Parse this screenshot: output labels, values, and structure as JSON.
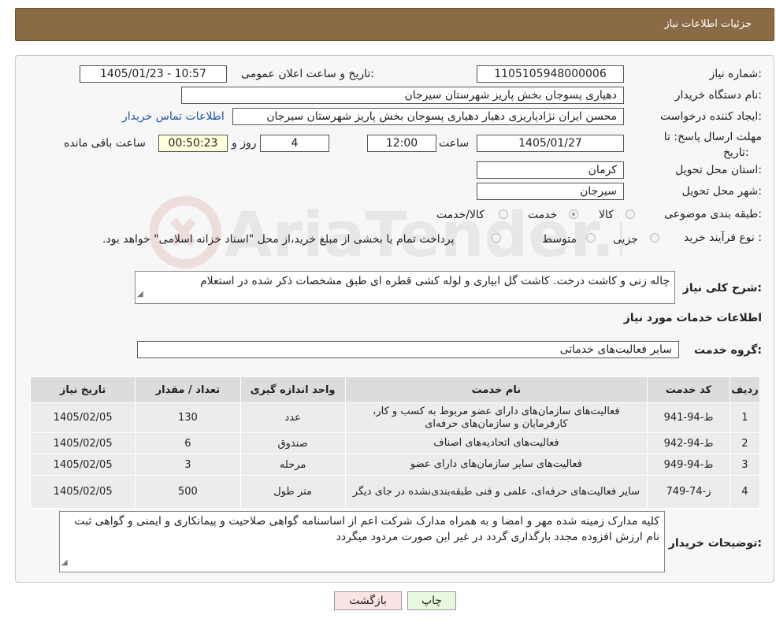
{
  "header": {
    "title": "جزئیات اطلاعات نیاز"
  },
  "form": {
    "need_number": {
      "label": "شماره نیاز:",
      "value": "1105105948000006"
    },
    "announce_datetime": {
      "label": "تاریخ و ساعت اعلان عمومی:",
      "value": "1405/01/23 - 10:57"
    },
    "buyer_org": {
      "label": "نام دستگاه خریدار:",
      "value": "دهیاری پسوجان بخش پاریز شهرستان سیرجان"
    },
    "requester": {
      "label": "ایجاد کننده درخواست:",
      "value": "محسن ایران نژادپاریزی دهیار دهیاری پسوجان بخش پاریز شهرستان سیرجان",
      "contact_link": "اطلاعات تماس خریدار"
    },
    "deadline": {
      "label": "مهلت ارسال پاسخ: تا تاریخ:",
      "date": "1405/01/27",
      "time_label": "ساعت",
      "time": "12:00",
      "days": "4",
      "days_label": "روز و",
      "remaining": "00:50:23",
      "remaining_label": "ساعت باقی مانده"
    },
    "delivery_province": {
      "label": "استان محل تحویل:",
      "value": "کرمان"
    },
    "delivery_city": {
      "label": "شهر محل تحویل:",
      "value": "سیرجان"
    },
    "category": {
      "label": "طبقه بندی موضوعی:",
      "options": [
        "کالا",
        "خدمت",
        "کالا/خدمت"
      ],
      "selected": "خدمت"
    },
    "purchase_process": {
      "label": "نوع فرآیند خرید :",
      "options": [
        "جزیی",
        "متوسط"
      ],
      "note": "پرداخت تمام یا بخشی از مبلغ خرید،از محل \"اسناد خزانه اسلامی\" خواهد بود."
    },
    "summary": {
      "label": "شرح کلی نیاز:",
      "value": "چاله زنی و کاشت درخت. کاشت گل ابیاری و لوله کشی قطره ای طبق مشخصات ذکر شده در استعلام"
    }
  },
  "services": {
    "section_title": "اطلاعات خدمات مورد نیاز",
    "group_label": "گروه خدمت:",
    "group_value": "سایر فعالیت‌های خدماتی",
    "columns": [
      "ردیف",
      "کد خدمت",
      "نام خدمت",
      "واحد اندازه گیری",
      "تعداد / مقدار",
      "تاریخ نیاز"
    ],
    "rows": [
      {
        "row": "1",
        "code": "ط-94-941",
        "name": "فعالیت‌های سازمان‌های دارای عضو مربوط به کسب و کار، کارفرمایان و سازمان‌های حرفه‌ای",
        "unit": "عدد",
        "qty": "130",
        "date": "1405/02/05"
      },
      {
        "row": "2",
        "code": "ط-94-942",
        "name": "فعالیت‌های اتحادیه‌های اصناف",
        "unit": "صندوق",
        "qty": "6",
        "date": "1405/02/05"
      },
      {
        "row": "3",
        "code": "ط-94-949",
        "name": "فعالیت‌های سایر سازمان‌های دارای عضو",
        "unit": "مرحله",
        "qty": "3",
        "date": "1405/02/05"
      },
      {
        "row": "4",
        "code": "ز-74-749",
        "name": "سایر فعالیت‌های حرفه‌ای، علمی و فنی طبقه‌بندی‌نشده در جای دیگر",
        "unit": "متر طول",
        "qty": "500",
        "date": "1405/02/05"
      }
    ]
  },
  "buyer_notes": {
    "label": "توضیحات خریدار:",
    "value": "کلیه مدارک زمینه شده مهر و امضا و به همراه مدارک شرکت اعم از اساسنامه گواهی صلاحیت و پیمانکاری و ایمنی و گواهی ثبت نام ارزش افزوده مجدد بارگذاری گردد در غیر این صورت مردود میگردد"
  },
  "actions": {
    "print": "چاپ",
    "back": "بازگشت"
  },
  "watermark": {
    "text": "AriaTender.neT"
  },
  "colors": {
    "header": "#8b6b46",
    "back_button": "#fde4e4",
    "print_button": "#e8f8e0"
  }
}
